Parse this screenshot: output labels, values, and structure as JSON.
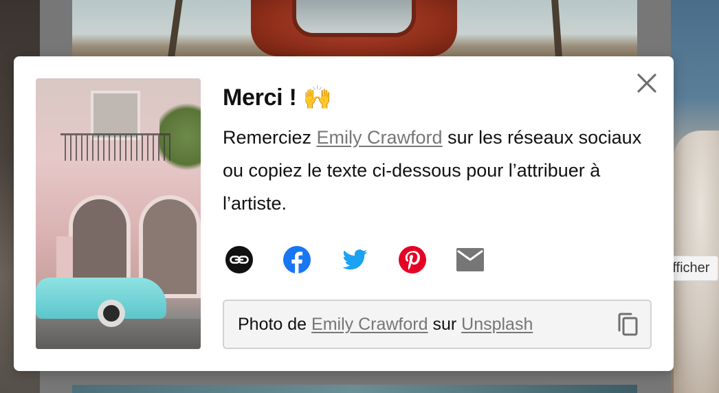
{
  "background": {
    "tooltip_text": "Afficher"
  },
  "modal": {
    "title": "Merci !",
    "title_emoji": "🙌",
    "description": {
      "before": "Remerciez ",
      "author": "Emily Crawford",
      "after": " sur les réseaux sociaux ou copiez le texte ci-dessous pour l’attribuer à l’artiste."
    },
    "share_buttons": [
      {
        "name": "copy-link",
        "icon": "link-icon",
        "color": "#111111"
      },
      {
        "name": "facebook",
        "icon": "facebook-icon",
        "color": "#1877f2"
      },
      {
        "name": "twitter",
        "icon": "twitter-icon",
        "color": "#1da1f2"
      },
      {
        "name": "pinterest",
        "icon": "pinterest-icon",
        "color": "#e60023"
      },
      {
        "name": "email",
        "icon": "mail-icon",
        "color": "#767676"
      }
    ],
    "credit": {
      "prefix": "Photo de ",
      "author": "Emily Crawford",
      "middle": " sur ",
      "source": "Unsplash"
    },
    "link_color": "#767676"
  }
}
